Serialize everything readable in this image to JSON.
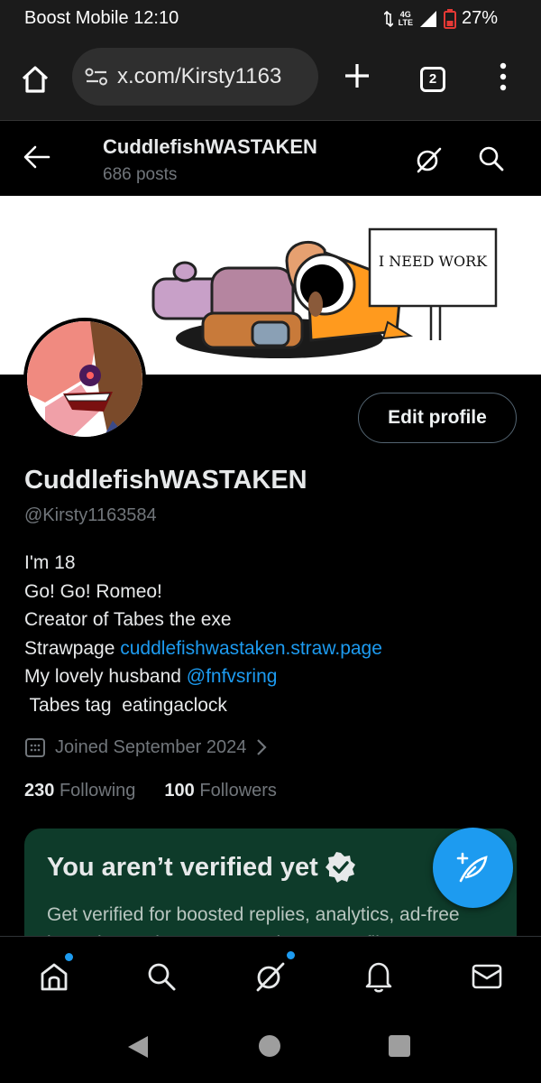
{
  "status_bar": {
    "carrier": "Boost Mobile",
    "time": "12:10",
    "network": "4G",
    "network_sub": "LTE",
    "battery": "27%"
  },
  "browser": {
    "url": "x.com/Kirsty1163",
    "tab_count": "2"
  },
  "profile_header": {
    "name": "CuddlefishWASTAKEN",
    "posts": "686 posts"
  },
  "banner": {
    "sign_text": "I NEED WORK"
  },
  "profile": {
    "display_name": "CuddlefishWASTAKEN",
    "handle": "@Kirsty1163584",
    "edit_button": "Edit profile",
    "bio": {
      "line1": "I'm 18",
      "line2": "Go! Go! Romeo!",
      "line3": "Creator of Tabes the exe",
      "line4_prefix": "Strawpage ",
      "line4_link": "cuddlefishwastaken.straw.page",
      "line5_prefix": "My lovely husband ",
      "line5_link": "@fnfvsring",
      "line6": " Tabes tag  eatingaclock"
    },
    "joined": "Joined September 2024",
    "following_count": "230",
    "following_label": "Following",
    "followers_count": "100",
    "followers_label": "Followers"
  },
  "verify_card": {
    "title": "You aren’t verified yet",
    "text": "Get verified for boosted replies, analytics, ad-free browsing and more. Upgrade your profile now."
  },
  "icons": {
    "home": "home-icon",
    "search": "search-icon",
    "grok": "grok-icon",
    "notifications": "bell-icon",
    "messages": "envelope-icon",
    "compose": "feather-plus-icon"
  },
  "colors": {
    "accent": "#1d9bf0",
    "background": "#000000",
    "card": "#0e3b2a",
    "muted": "#71767b"
  }
}
